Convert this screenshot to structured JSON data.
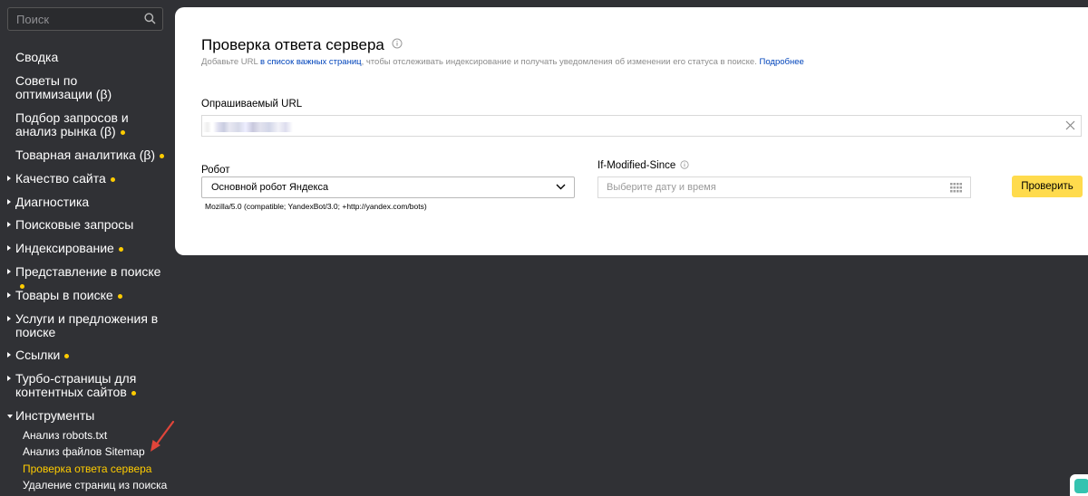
{
  "sidebar": {
    "search_placeholder": "Поиск",
    "items": [
      {
        "label_1": "Сводка"
      },
      {
        "label_1": "Советы по",
        "label_2": "оптимизации (β)"
      },
      {
        "label_1": "Подбор запросов и",
        "label_2": "анализ рынка (β)"
      },
      {
        "label_1": "Товарная аналитика (β)"
      },
      {
        "label_1": "Качество сайта"
      },
      {
        "label_1": "Диагностика"
      },
      {
        "label_1": "Поисковые запросы"
      },
      {
        "label_1": "Индексирование"
      },
      {
        "label_1": "Представление в поиске"
      },
      {
        "label_1": "Товары в поиске"
      },
      {
        "label_1": "Услуги и предложения в",
        "label_2": "поиске"
      },
      {
        "label_1": "Ссылки"
      },
      {
        "label_1": "Турбо-страницы для",
        "label_2": "контентных сайтов"
      },
      {
        "label_1": "Инструменты"
      }
    ],
    "tools": [
      "Анализ robots.txt",
      "Анализ файлов Sitemap",
      "Проверка ответа сервера",
      "Удаление страниц из поиска"
    ]
  },
  "main": {
    "title": "Проверка ответа сервера",
    "subtitle_prefix": "Добавьте URL ",
    "subtitle_link": "в список важных страниц",
    "subtitle_middle": ", чтобы отслеживать индексирование и получать уведомления об изменении его статуса в поиске. ",
    "subtitle_more": "Подробнее",
    "url_label": "Опрашиваемый URL",
    "robot_label": "Робот",
    "robot_value": "Основной робот Яндекса",
    "user_agent": "Mozilla/5.0 (compatible; YandexBot/3.0; +http://yandex.com/bots)",
    "ims_label": "If-Modified-Since",
    "date_placeholder": "Выберите дату и время",
    "check_button": "Проверить"
  },
  "colors": {
    "sidebar_bg": "#303135",
    "accent_yellow": "#ffcc00",
    "button_yellow": "#ffdb4d",
    "link_blue": "#0044bb"
  }
}
